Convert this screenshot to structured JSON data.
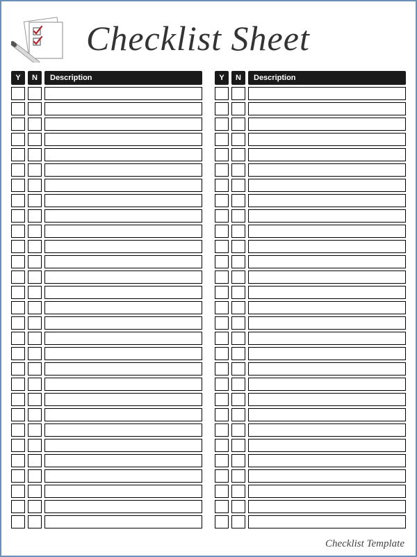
{
  "title": "Checklist Sheet",
  "headers": {
    "yes": "Y",
    "no": "N",
    "description": "Description"
  },
  "row_count": 29,
  "column_count": 2,
  "rows_left": [
    {
      "y": "",
      "n": "",
      "description": ""
    },
    {
      "y": "",
      "n": "",
      "description": ""
    },
    {
      "y": "",
      "n": "",
      "description": ""
    },
    {
      "y": "",
      "n": "",
      "description": ""
    },
    {
      "y": "",
      "n": "",
      "description": ""
    },
    {
      "y": "",
      "n": "",
      "description": ""
    },
    {
      "y": "",
      "n": "",
      "description": ""
    },
    {
      "y": "",
      "n": "",
      "description": ""
    },
    {
      "y": "",
      "n": "",
      "description": ""
    },
    {
      "y": "",
      "n": "",
      "description": ""
    },
    {
      "y": "",
      "n": "",
      "description": ""
    },
    {
      "y": "",
      "n": "",
      "description": ""
    },
    {
      "y": "",
      "n": "",
      "description": ""
    },
    {
      "y": "",
      "n": "",
      "description": ""
    },
    {
      "y": "",
      "n": "",
      "description": ""
    },
    {
      "y": "",
      "n": "",
      "description": ""
    },
    {
      "y": "",
      "n": "",
      "description": ""
    },
    {
      "y": "",
      "n": "",
      "description": ""
    },
    {
      "y": "",
      "n": "",
      "description": ""
    },
    {
      "y": "",
      "n": "",
      "description": ""
    },
    {
      "y": "",
      "n": "",
      "description": ""
    },
    {
      "y": "",
      "n": "",
      "description": ""
    },
    {
      "y": "",
      "n": "",
      "description": ""
    },
    {
      "y": "",
      "n": "",
      "description": ""
    },
    {
      "y": "",
      "n": "",
      "description": ""
    },
    {
      "y": "",
      "n": "",
      "description": ""
    },
    {
      "y": "",
      "n": "",
      "description": ""
    },
    {
      "y": "",
      "n": "",
      "description": ""
    },
    {
      "y": "",
      "n": "",
      "description": ""
    }
  ],
  "rows_right": [
    {
      "y": "",
      "n": "",
      "description": ""
    },
    {
      "y": "",
      "n": "",
      "description": ""
    },
    {
      "y": "",
      "n": "",
      "description": ""
    },
    {
      "y": "",
      "n": "",
      "description": ""
    },
    {
      "y": "",
      "n": "",
      "description": ""
    },
    {
      "y": "",
      "n": "",
      "description": ""
    },
    {
      "y": "",
      "n": "",
      "description": ""
    },
    {
      "y": "",
      "n": "",
      "description": ""
    },
    {
      "y": "",
      "n": "",
      "description": ""
    },
    {
      "y": "",
      "n": "",
      "description": ""
    },
    {
      "y": "",
      "n": "",
      "description": ""
    },
    {
      "y": "",
      "n": "",
      "description": ""
    },
    {
      "y": "",
      "n": "",
      "description": ""
    },
    {
      "y": "",
      "n": "",
      "description": ""
    },
    {
      "y": "",
      "n": "",
      "description": ""
    },
    {
      "y": "",
      "n": "",
      "description": ""
    },
    {
      "y": "",
      "n": "",
      "description": ""
    },
    {
      "y": "",
      "n": "",
      "description": ""
    },
    {
      "y": "",
      "n": "",
      "description": ""
    },
    {
      "y": "",
      "n": "",
      "description": ""
    },
    {
      "y": "",
      "n": "",
      "description": ""
    },
    {
      "y": "",
      "n": "",
      "description": ""
    },
    {
      "y": "",
      "n": "",
      "description": ""
    },
    {
      "y": "",
      "n": "",
      "description": ""
    },
    {
      "y": "",
      "n": "",
      "description": ""
    },
    {
      "y": "",
      "n": "",
      "description": ""
    },
    {
      "y": "",
      "n": "",
      "description": ""
    },
    {
      "y": "",
      "n": "",
      "description": ""
    },
    {
      "y": "",
      "n": "",
      "description": ""
    }
  ],
  "footer": "Checklist Template"
}
